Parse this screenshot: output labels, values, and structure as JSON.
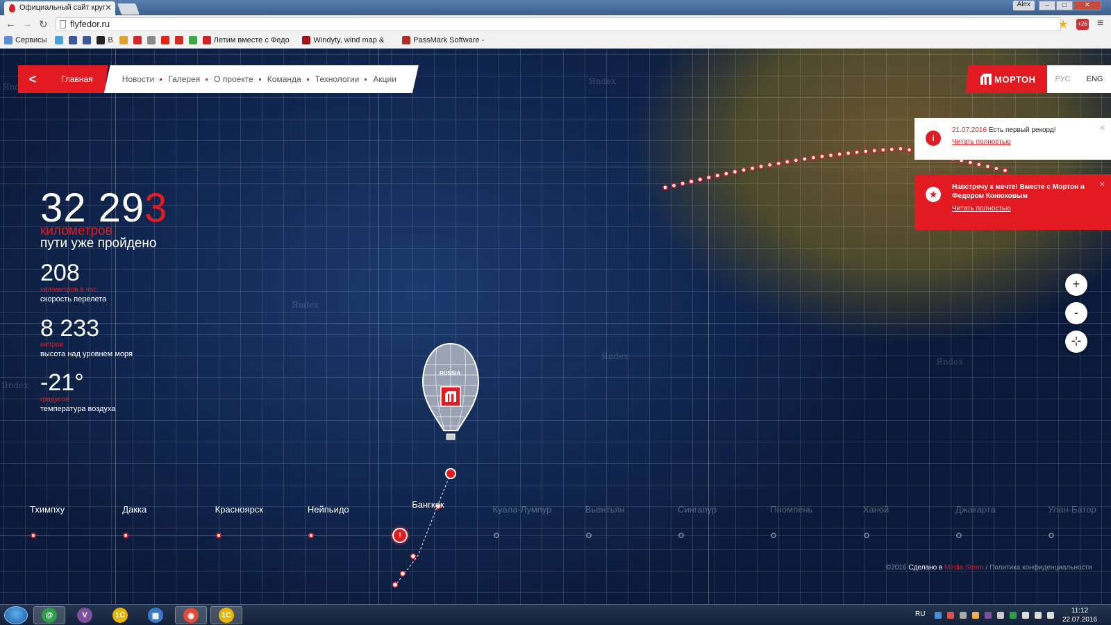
{
  "browser": {
    "tab_title": "Официальный сайт круг",
    "tab_close": "✕",
    "user_name": "Alex",
    "url": "flyfedor.ru",
    "extension_badge": "+26",
    "bookmarks": [
      {
        "label": "Сервисы",
        "color": "#5a8ed6"
      },
      {
        "label": "",
        "color": "#4aa1d9"
      },
      {
        "label": "",
        "color": "#3b5998"
      },
      {
        "label": "",
        "color": "#3b5998"
      },
      {
        "label": "B",
        "color": "#222222"
      },
      {
        "label": "",
        "color": "#e0a030"
      },
      {
        "label": "",
        "color": "#d62828"
      },
      {
        "label": "",
        "color": "#888888"
      },
      {
        "label": "",
        "color": "#e62117"
      },
      {
        "label": "",
        "color": "#d52b1e"
      },
      {
        "label": "",
        "color": "#3aa845"
      },
      {
        "label": "Летим вместе с Федо",
        "color": "#d62028"
      },
      {
        "label": "Windyty, wind map &",
        "color": "#a4141d"
      },
      {
        "label": "PassMark Software -",
        "color": "#b03030"
      }
    ]
  },
  "nav": {
    "back_label": "<",
    "home_label": "Главная",
    "items": [
      "Новости",
      "Галерея",
      "О проекте",
      "Команда",
      "Технологии",
      "Акции"
    ]
  },
  "brand": {
    "name": "МОРТОН",
    "lang_ru": "РУС",
    "lang_en": "ENG"
  },
  "stats": {
    "distance_main": "32 29",
    "distance_accent": "3",
    "distance_unit": "километров",
    "distance_desc": "пути уже пройдено",
    "speed_value": "208",
    "speed_unit": "километров в час",
    "speed_desc": "скорость перелета",
    "altitude_value": "8 233",
    "altitude_unit": "метров",
    "altitude_desc": "высота над уровнем моря",
    "temp_value": "-21°",
    "temp_unit": "градусов",
    "temp_desc": "температура воздуха"
  },
  "notifications": [
    {
      "icon": "i",
      "date": "21.07.2016",
      "text": " Есть первый рекорд!",
      "link": "Читать полностью"
    },
    {
      "icon": "★",
      "text": "Навстречу к мечте! Вместе с Мортон и Федором Конюховым",
      "link": "Читать полностью"
    }
  ],
  "zoom": {
    "in": "+",
    "out": "-",
    "locate": "⊹"
  },
  "balloon": {
    "label": "RUSSIA"
  },
  "map": {
    "watermark": "Яndex"
  },
  "cities": [
    {
      "name": "Тхимпху",
      "passed": true
    },
    {
      "name": "Дакка",
      "passed": true
    },
    {
      "name": "Красноярск",
      "passed": true
    },
    {
      "name": "Нейпьидо",
      "passed": true
    },
    {
      "name": "Бангкок",
      "passed": true
    },
    {
      "name": "Куала-Лумпур",
      "passed": false
    },
    {
      "name": "Вьентьян",
      "passed": false
    },
    {
      "name": "Сингапур",
      "passed": false
    },
    {
      "name": "Пномпень",
      "passed": false
    },
    {
      "name": "Ханой",
      "passed": false
    },
    {
      "name": "Джакарта",
      "passed": false
    },
    {
      "name": "Улан-Батор",
      "passed": false
    }
  ],
  "footer": {
    "copyright": "©2016 ",
    "made_in": "Сделано в ",
    "studio": "Media Storm",
    "privacy": "/ Политика конфиденциальности"
  },
  "taskbar": {
    "lang": "RU",
    "time": "11:12",
    "date": "22.07.2016",
    "apps": [
      {
        "label": "@",
        "color": "#2e9e4a",
        "active": true
      },
      {
        "label": "V",
        "color": "#7b519d",
        "active": false
      },
      {
        "label": "1С",
        "color": "#e8b400",
        "active": false
      },
      {
        "label": "▦",
        "color": "#3b78c8",
        "active": false
      },
      {
        "label": "◉",
        "color": "#dd4b39",
        "active": true
      },
      {
        "label": "1С",
        "color": "#e8b400",
        "active": true
      }
    ]
  }
}
